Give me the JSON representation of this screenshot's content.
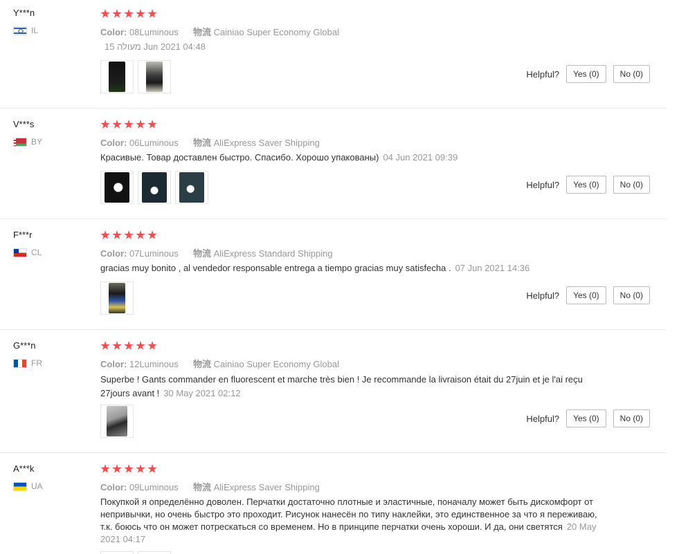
{
  "reviews": [
    {
      "user": "Y***n",
      "country": "IL",
      "color_label": "Color:",
      "color": "08Luminous",
      "ship_label": "物流",
      "shipping": "Cainiao Super Economy Global",
      "text": "",
      "date": "15 מעולה Jun 2021 04:48",
      "helpful": "Helpful?",
      "yes": "Yes (0)",
      "no": "No (0)"
    },
    {
      "user": "V***s",
      "country": "BY",
      "color_label": "Color:",
      "color": "06Luminous",
      "ship_label": "物流",
      "shipping": "AliExpress Saver Shipping",
      "text": "Красивые. Товар доставлен быстро. Спасибо. Хорошо упакованы)",
      "date": "04 Jun 2021 09:39",
      "helpful": "Helpful?",
      "yes": "Yes (0)",
      "no": "No (0)"
    },
    {
      "user": "F***r",
      "country": "CL",
      "color_label": "Color:",
      "color": "07Luminous",
      "ship_label": "物流",
      "shipping": "AliExpress Standard Shipping",
      "text": "gracias muy bonito , al vendedor responsable entrega a tiempo gracias muy satisfecha .",
      "date": "07 Jun 2021 14:36",
      "helpful": "Helpful?",
      "yes": "Yes (0)",
      "no": "No (0)"
    },
    {
      "user": "G***n",
      "country": "FR",
      "color_label": "Color:",
      "color": "12Luminous",
      "ship_label": "物流",
      "shipping": "Cainiao Super Economy Global",
      "text": "Superbe ! Gants commander en fluorescent et marche très bien ! Je recommande la livraison était du 27juin et je l'ai reçu 27jours avant !",
      "date": "30 May 2021 02:12",
      "helpful": "Helpful?",
      "yes": "Yes (0)",
      "no": "No (0)"
    },
    {
      "user": "A***k",
      "country": "UA",
      "color_label": "Color:",
      "color": "09Luminous",
      "ship_label": "物流",
      "shipping": "AliExpress Saver Shipping",
      "text": "Покупкой я определённо доволен. Перчатки достаточно плотные и эластичные, поначалу может быть дискомфорт от непривычки, но очень быстро это проходит. Рисунок нанесён по типу наклейки, это единственное за что я переживаю, т.к. боюсь что он может потрескаться со временем. Но в принципе перчатки очень хороши. И да, они светятся",
      "date": "20 May 2021 04:17",
      "helpful": "Helpful?",
      "yes": "Yes (0)",
      "no": "No (0)"
    }
  ],
  "colors": {
    "star": "#f44c4a",
    "muted": "#999999",
    "text": "#333333",
    "divider": "#e8e8e8"
  }
}
